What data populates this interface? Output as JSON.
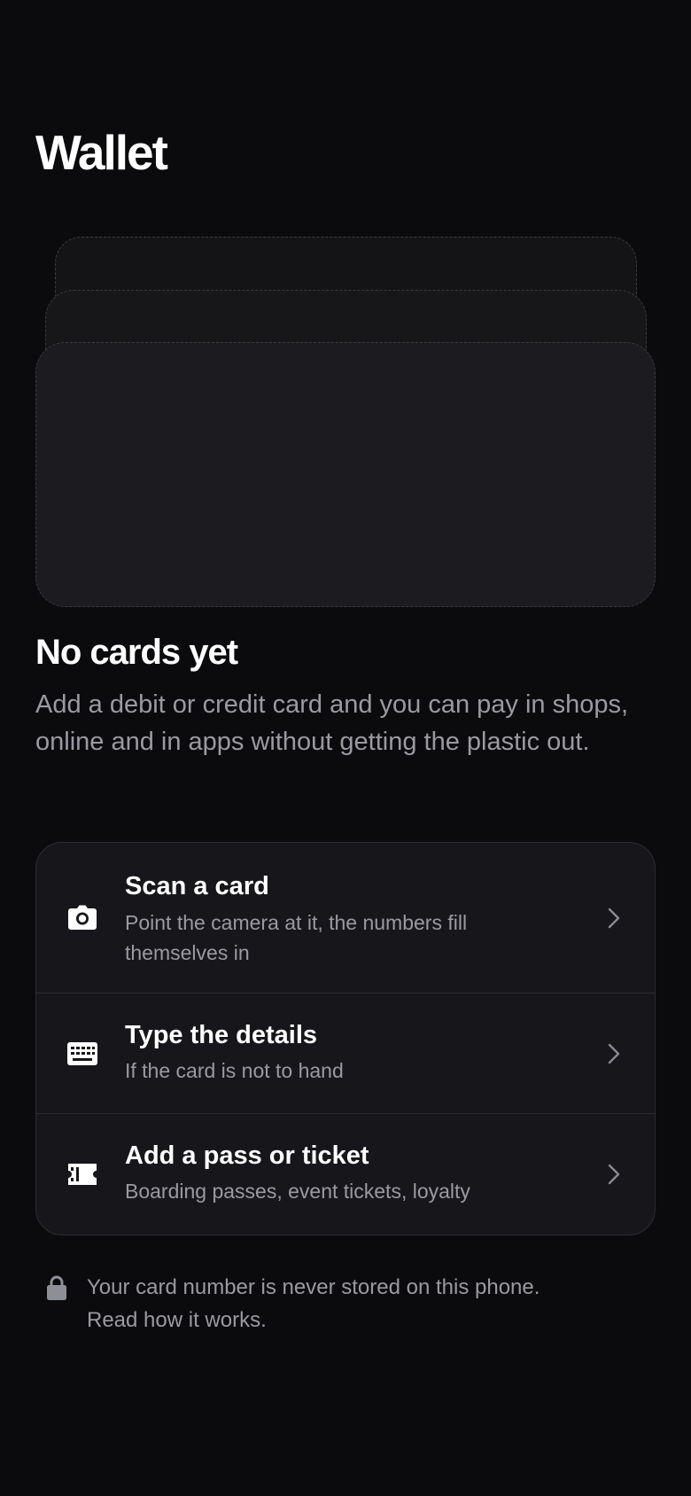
{
  "header": {
    "title": "Wallet"
  },
  "empty_state": {
    "title": "No cards yet",
    "body": "Add a debit or credit card and you can pay in shops, online and in apps without getting the plastic out."
  },
  "options": [
    {
      "title": "Scan a card",
      "subtitle": "Point the camera at it, the numbers fill themselves in",
      "icon": "camera-icon"
    },
    {
      "title": "Type the details",
      "subtitle": "If the card is not to hand",
      "icon": "keyboard-icon"
    },
    {
      "title": "Add a pass or ticket",
      "subtitle": "Boarding passes, event tickets, loyalty",
      "icon": "ticket-icon"
    }
  ],
  "footer": {
    "note": "Your card number is never stored on this phone.",
    "link": "Read how it works.",
    "icon": "lock-icon"
  },
  "colors": {
    "background": "#0b0b0d",
    "surface": "#17171b",
    "muted_text": "#9a9aa2",
    "divider": "#2c2c31"
  }
}
